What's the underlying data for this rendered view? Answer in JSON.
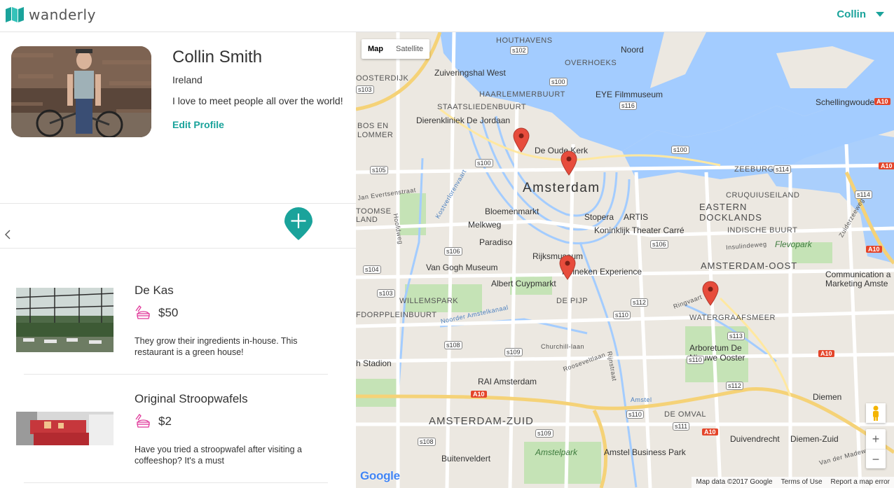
{
  "header": {
    "brand": "wanderly",
    "user_name": "Collin",
    "brand_color": "#1aa39b"
  },
  "profile": {
    "name": "Collin Smith",
    "country": "Ireland",
    "bio": "I love to meet people all over the world!",
    "edit_label": "Edit Profile"
  },
  "places": [
    {
      "name": "De Kas",
      "price": "$50",
      "description": "They grow their ingredients in-house. This restaurant is a green house!"
    },
    {
      "name": "Original Stroopwafels",
      "price": "$2",
      "description": "Have you tried a stroopwafel after visiting a coffeeshop? It's a must"
    }
  ],
  "map": {
    "type_map": "Map",
    "type_satellite": "Satellite",
    "city": "Amsterdam",
    "districts": [
      "HOUTHAVENS",
      "OVERHOEKS",
      "Noord",
      "HAARLEMMERBUURT",
      "STAATSLIEDENBUURT",
      "BOS EN LOMMER",
      "OOSTERDIJK",
      "ZEEBURG",
      "CRUQUIUSEILAND",
      "EASTERN DOCKLANDS",
      "INDISCHE BUURT",
      "AMSTERDAM-OOST",
      "WILLEMSPARK",
      "FDORPPLEINBUURT",
      "DE PIJP",
      "WATERGRAAFSMEER",
      "AMSTERDAM-ZUID",
      "DE OMVAL",
      "TOOMSE LAND",
      "Schellingwoude",
      "Diemen",
      "Duivendrecht",
      "Diemen-Zuid",
      "Buitenveldert"
    ],
    "pois": [
      "Zuiveringshal West",
      "EYE Filmmuseum",
      "Dierenkliniek De Jordaan",
      "De Oude Kerk",
      "Bloemenmarkt",
      "Stopera",
      "ARTIS",
      "Melkweg",
      "Koninklijk Theater Carré",
      "Paradiso",
      "Rijksmuseum",
      "Van Gogh Museum",
      "Heineken Experience",
      "Albert Cuypmarkt",
      "Arboretum De Nieuwe Ooster",
      "RAI Amsterdam",
      "Amstelpark",
      "Amstel Business Park",
      "h Stadion",
      "Communication a Marketing Amste",
      "Flevopark"
    ],
    "streets": [
      "Jan Evertsenstraat",
      "Hoofdweg",
      "Churchill-laan",
      "Rooseveltlaan",
      "Rijnstraat",
      "Insulindeweg",
      "Ringvaart",
      "Van der Madeweg",
      "Noorder Amstelkanaal",
      "Kostverlorenvaart",
      "Amstel",
      "Zuiderzeeweg"
    ],
    "road_tags": [
      "s102",
      "s103",
      "s100",
      "s116",
      "s105",
      "s100",
      "s100",
      "s114",
      "s114",
      "s106",
      "s106",
      "s104",
      "s103",
      "s108",
      "s109",
      "s110",
      "s112",
      "s113",
      "s110",
      "s112",
      "s109",
      "s111",
      "s108",
      "s110",
      "s100",
      "s103"
    ],
    "highway": "A10",
    "attribution_data": "Map data ©2017 Google",
    "attribution_terms": "Terms of Use",
    "attribution_report": "Report a map error",
    "google": "Google",
    "zoom_in": "+",
    "zoom_out": "−"
  }
}
